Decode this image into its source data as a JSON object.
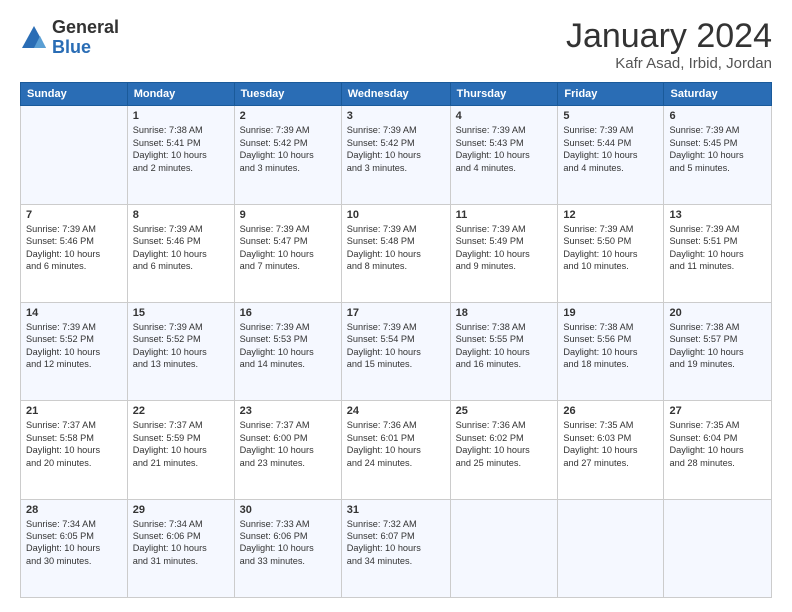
{
  "header": {
    "logo_general": "General",
    "logo_blue": "Blue",
    "month_title": "January 2024",
    "location": "Kafr Asad, Irbid, Jordan"
  },
  "days_of_week": [
    "Sunday",
    "Monday",
    "Tuesday",
    "Wednesday",
    "Thursday",
    "Friday",
    "Saturday"
  ],
  "weeks": [
    [
      {
        "day": "",
        "info": ""
      },
      {
        "day": "1",
        "info": "Sunrise: 7:38 AM\nSunset: 5:41 PM\nDaylight: 10 hours\nand 2 minutes."
      },
      {
        "day": "2",
        "info": "Sunrise: 7:39 AM\nSunset: 5:42 PM\nDaylight: 10 hours\nand 3 minutes."
      },
      {
        "day": "3",
        "info": "Sunrise: 7:39 AM\nSunset: 5:42 PM\nDaylight: 10 hours\nand 3 minutes."
      },
      {
        "day": "4",
        "info": "Sunrise: 7:39 AM\nSunset: 5:43 PM\nDaylight: 10 hours\nand 4 minutes."
      },
      {
        "day": "5",
        "info": "Sunrise: 7:39 AM\nSunset: 5:44 PM\nDaylight: 10 hours\nand 4 minutes."
      },
      {
        "day": "6",
        "info": "Sunrise: 7:39 AM\nSunset: 5:45 PM\nDaylight: 10 hours\nand 5 minutes."
      }
    ],
    [
      {
        "day": "7",
        "info": "Sunrise: 7:39 AM\nSunset: 5:46 PM\nDaylight: 10 hours\nand 6 minutes."
      },
      {
        "day": "8",
        "info": "Sunrise: 7:39 AM\nSunset: 5:46 PM\nDaylight: 10 hours\nand 6 minutes."
      },
      {
        "day": "9",
        "info": "Sunrise: 7:39 AM\nSunset: 5:47 PM\nDaylight: 10 hours\nand 7 minutes."
      },
      {
        "day": "10",
        "info": "Sunrise: 7:39 AM\nSunset: 5:48 PM\nDaylight: 10 hours\nand 8 minutes."
      },
      {
        "day": "11",
        "info": "Sunrise: 7:39 AM\nSunset: 5:49 PM\nDaylight: 10 hours\nand 9 minutes."
      },
      {
        "day": "12",
        "info": "Sunrise: 7:39 AM\nSunset: 5:50 PM\nDaylight: 10 hours\nand 10 minutes."
      },
      {
        "day": "13",
        "info": "Sunrise: 7:39 AM\nSunset: 5:51 PM\nDaylight: 10 hours\nand 11 minutes."
      }
    ],
    [
      {
        "day": "14",
        "info": "Sunrise: 7:39 AM\nSunset: 5:52 PM\nDaylight: 10 hours\nand 12 minutes."
      },
      {
        "day": "15",
        "info": "Sunrise: 7:39 AM\nSunset: 5:52 PM\nDaylight: 10 hours\nand 13 minutes."
      },
      {
        "day": "16",
        "info": "Sunrise: 7:39 AM\nSunset: 5:53 PM\nDaylight: 10 hours\nand 14 minutes."
      },
      {
        "day": "17",
        "info": "Sunrise: 7:39 AM\nSunset: 5:54 PM\nDaylight: 10 hours\nand 15 minutes."
      },
      {
        "day": "18",
        "info": "Sunrise: 7:38 AM\nSunset: 5:55 PM\nDaylight: 10 hours\nand 16 minutes."
      },
      {
        "day": "19",
        "info": "Sunrise: 7:38 AM\nSunset: 5:56 PM\nDaylight: 10 hours\nand 18 minutes."
      },
      {
        "day": "20",
        "info": "Sunrise: 7:38 AM\nSunset: 5:57 PM\nDaylight: 10 hours\nand 19 minutes."
      }
    ],
    [
      {
        "day": "21",
        "info": "Sunrise: 7:37 AM\nSunset: 5:58 PM\nDaylight: 10 hours\nand 20 minutes."
      },
      {
        "day": "22",
        "info": "Sunrise: 7:37 AM\nSunset: 5:59 PM\nDaylight: 10 hours\nand 21 minutes."
      },
      {
        "day": "23",
        "info": "Sunrise: 7:37 AM\nSunset: 6:00 PM\nDaylight: 10 hours\nand 23 minutes."
      },
      {
        "day": "24",
        "info": "Sunrise: 7:36 AM\nSunset: 6:01 PM\nDaylight: 10 hours\nand 24 minutes."
      },
      {
        "day": "25",
        "info": "Sunrise: 7:36 AM\nSunset: 6:02 PM\nDaylight: 10 hours\nand 25 minutes."
      },
      {
        "day": "26",
        "info": "Sunrise: 7:35 AM\nSunset: 6:03 PM\nDaylight: 10 hours\nand 27 minutes."
      },
      {
        "day": "27",
        "info": "Sunrise: 7:35 AM\nSunset: 6:04 PM\nDaylight: 10 hours\nand 28 minutes."
      }
    ],
    [
      {
        "day": "28",
        "info": "Sunrise: 7:34 AM\nSunset: 6:05 PM\nDaylight: 10 hours\nand 30 minutes."
      },
      {
        "day": "29",
        "info": "Sunrise: 7:34 AM\nSunset: 6:06 PM\nDaylight: 10 hours\nand 31 minutes."
      },
      {
        "day": "30",
        "info": "Sunrise: 7:33 AM\nSunset: 6:06 PM\nDaylight: 10 hours\nand 33 minutes."
      },
      {
        "day": "31",
        "info": "Sunrise: 7:32 AM\nSunset: 6:07 PM\nDaylight: 10 hours\nand 34 minutes."
      },
      {
        "day": "",
        "info": ""
      },
      {
        "day": "",
        "info": ""
      },
      {
        "day": "",
        "info": ""
      }
    ]
  ]
}
